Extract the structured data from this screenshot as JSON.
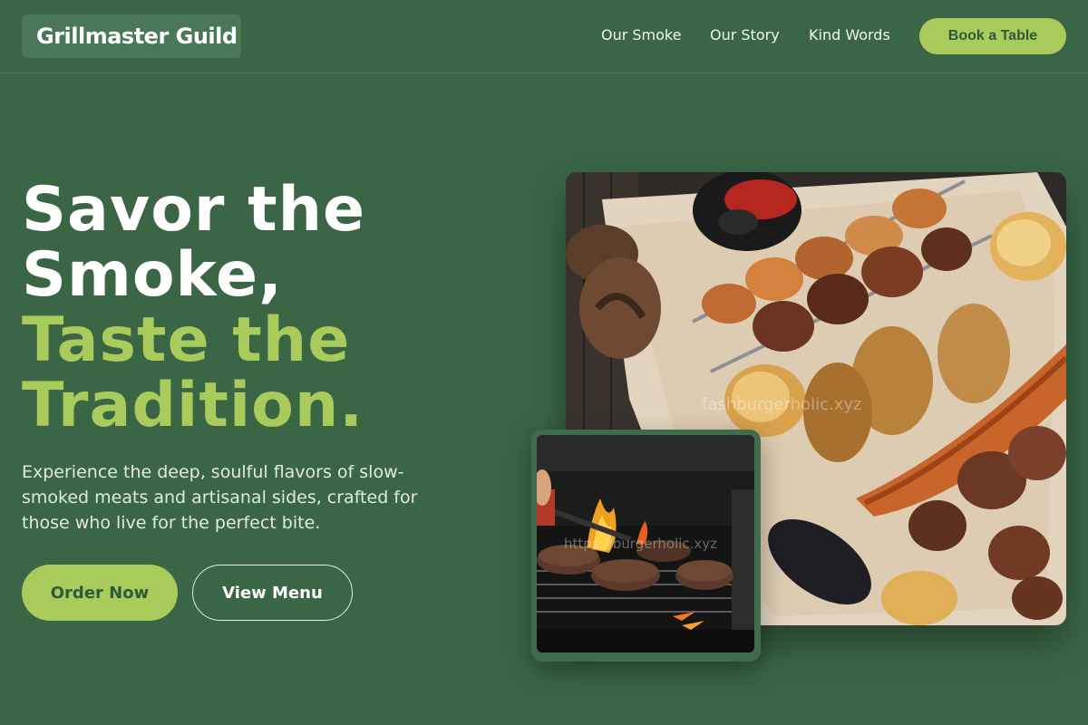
{
  "brand": {
    "name": "Grillmaster Guild"
  },
  "nav": {
    "items": [
      {
        "label": "Our Smoke"
      },
      {
        "label": "Our Story"
      },
      {
        "label": "Kind Words"
      }
    ],
    "cta_label": "Book a Table"
  },
  "hero": {
    "title_line1": "Savor the",
    "title_line2": "Smoke,",
    "title_line3": "Taste the",
    "title_line4": "Tradition.",
    "subtitle": "Experience the deep, soulful flavors of slow-smoked meats and artisanal sides, crafted for those who live for the perfect bite.",
    "primary_button": "Order Now",
    "secondary_button": "View Menu"
  },
  "images": {
    "main_watermark": "fashburgerholic.xyz",
    "grill_watermark": "https://burgerholic.xyz"
  },
  "colors": {
    "background": "#3a6645",
    "accent": "#a8cb5c",
    "accent_text": "#2f5a39"
  }
}
